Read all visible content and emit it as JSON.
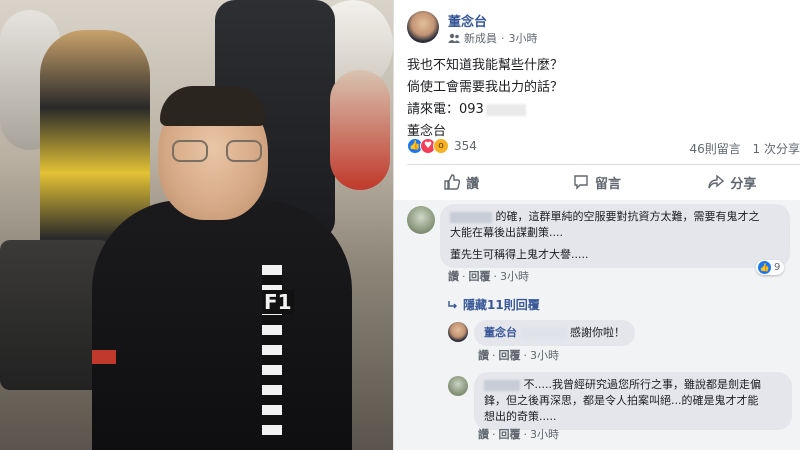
{
  "post": {
    "author": "董念台",
    "badge": "新成員",
    "time": "3小時",
    "lines": [
      "我也不知道我能幫些什麼？",
      "倘使工會需要我出力的話？",
      "請來電：093",
      "董念台"
    ],
    "reaction_count": "354",
    "comments_count": "46則留言",
    "shares_count": "1 次分享",
    "actions": {
      "like": "讚",
      "comment": "留言",
      "share": "分享"
    }
  },
  "comments": [
    {
      "text_line1": "的確，這群單純的空服要對抗資方太難，需要有鬼才之",
      "text_line2": "大能在幕後出謀劃策....",
      "text_line3": "董先生可稱得上鬼才大譽.....",
      "like": "讚",
      "reply": "回覆",
      "time": "3小時",
      "reaction_count": "9"
    },
    {
      "replies_label": "隱藏11則回覆"
    },
    {
      "author": "董念台",
      "text": "感謝你啦！",
      "like": "讚",
      "reply": "回覆",
      "time": "3小時"
    },
    {
      "text_line1": "不.....我曾經研究過您所行之事，雖說都是劍走偏",
      "text_line2": "鋒，但之後再深思，都是令人拍案叫絕...的確是鬼才才能",
      "text_line3": "想出的奇策.....",
      "like": "讚",
      "reply": "回覆",
      "time": "3小時"
    }
  ],
  "photo": {
    "shirt_logo": "F1"
  },
  "colors": {
    "link": "#385898",
    "like": "#1877f2",
    "love": "#f33e58",
    "wow": "#f7b125",
    "comment_bg": "#f2f3f5"
  }
}
